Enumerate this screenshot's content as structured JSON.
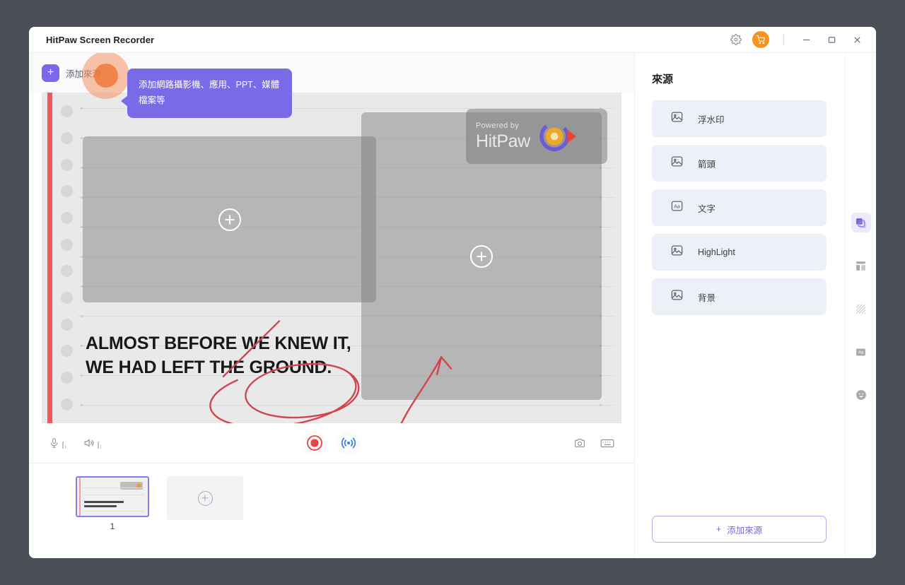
{
  "window": {
    "title": "HitPaw Screen Recorder",
    "controls": {
      "settings_icon": "gear-icon",
      "cart_icon": "cart-icon",
      "minimize": "−",
      "maximize": "□",
      "close": "✕"
    }
  },
  "sourcebar": {
    "add_source_label": "添加來源",
    "plus": "+",
    "tooltip": "添加網路攝影機、應用、PPT、媒體檔案等"
  },
  "canvas": {
    "watermark": {
      "powered_by": "Powered by",
      "brand": "HitPaw"
    },
    "headline_line1": "ALMOST BEFORE WE KNEW IT,",
    "headline_line2": "WE HAD LEFT THE GROUND.",
    "placeholder_plus": "+",
    "annotation_color": "#d1454f",
    "margin_color": "#f4565c"
  },
  "toolstrip": {
    "mic_icon": "microphone-icon",
    "speaker_icon": "speaker-icon",
    "record_icon": "record-icon",
    "live_icon": "broadcast-icon",
    "screenshot_icon": "camera-icon",
    "keyboard_icon": "keyboard-icon",
    "record_color": "#ef4043",
    "live_color": "#3b7fe0"
  },
  "thumbnails": {
    "items": [
      {
        "number": "1",
        "selected": true
      }
    ],
    "add_label": "+"
  },
  "panel": {
    "title": "來源",
    "items": [
      {
        "label": "浮水印",
        "icon": "image-icon"
      },
      {
        "label": "箭頭",
        "icon": "image-icon"
      },
      {
        "label": "文字",
        "icon": "text-aa-icon"
      },
      {
        "label": "HighLight",
        "icon": "image-icon"
      },
      {
        "label": "背景",
        "icon": "image-icon"
      }
    ],
    "add_button": {
      "plus": "+",
      "label": "添加來源"
    },
    "accent_color": "#7b6ae8"
  },
  "rail": {
    "items": [
      {
        "icon": "layers-icon",
        "active": true
      },
      {
        "icon": "layout-icon",
        "active": false
      },
      {
        "icon": "texture-icon",
        "active": false
      },
      {
        "icon": "text-aa-icon",
        "active": false
      },
      {
        "icon": "emoji-icon",
        "active": false
      }
    ]
  }
}
